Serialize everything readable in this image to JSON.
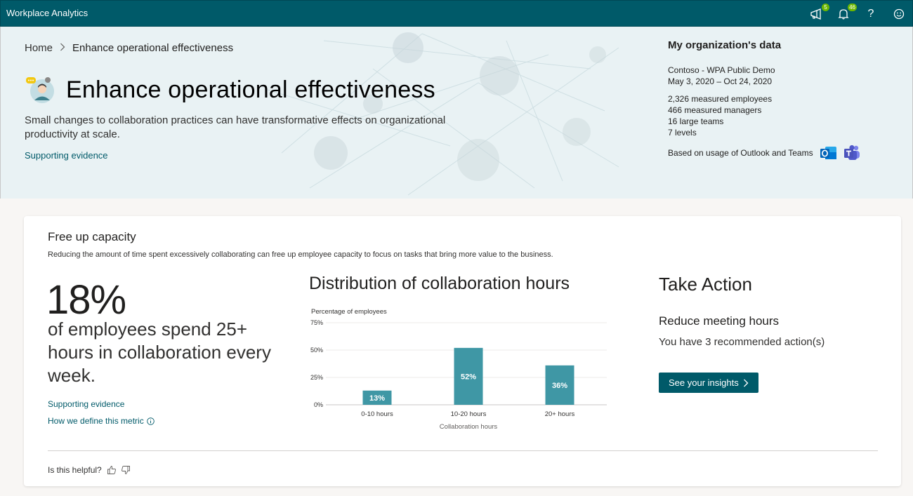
{
  "app": {
    "title": "Workplace Analytics"
  },
  "topbar": {
    "announcements_badge": "5",
    "notifications_badge": "46",
    "help_symbol": "?"
  },
  "breadcrumb": {
    "home": "Home",
    "current": "Enhance operational effectiveness"
  },
  "hero": {
    "title": "Enhance operational effectiveness",
    "description": "Small changes to collaboration practices can have transformative effects on organizational productivity at scale.",
    "link": "Supporting evidence"
  },
  "org": {
    "heading": "My organization's data",
    "name": "Contoso - WPA Public Demo",
    "date_range": "May 3, 2020 – Oct 24, 2020",
    "employees": "2,326 measured employees",
    "managers": "466 measured managers",
    "teams": "16 large teams",
    "levels": "7 levels",
    "usage_text": "Based on usage of Outlook and Teams"
  },
  "card": {
    "title": "Free up capacity",
    "subtitle": "Reducing the amount of time spent excessively collaborating can free up employee capacity to focus on tasks that bring more value to the business.",
    "stat_value": "18%",
    "stat_text": "of employees spend 25+ hours in collaboration every week.",
    "link_evidence": "Supporting evidence",
    "link_define": "How we define this metric",
    "chart_title": "Distribution of collaboration hours",
    "action_title": "Take Action",
    "action_subtitle": "Reduce meeting hours",
    "action_text": "You have 3 recommended action(s)",
    "action_button": "See your insights",
    "helpful": "Is this helpful?"
  },
  "colors": {
    "brand": "#005a69",
    "bar": "#3f97a5",
    "badge": "#6bb700"
  },
  "chart_data": {
    "type": "bar",
    "title": "Distribution of collaboration hours",
    "ylabel": "Percentage of employees",
    "xlabel": "Collaboration hours",
    "categories": [
      "0-10 hours",
      "10-20 hours",
      "20+ hours"
    ],
    "values": [
      13,
      52,
      36
    ],
    "value_labels": [
      "13%",
      "52%",
      "36%"
    ],
    "yticks": [
      "75%",
      "50%",
      "25%",
      "0%"
    ],
    "ytick_values": [
      75,
      50,
      25,
      0
    ],
    "ylim": [
      0,
      75
    ],
    "grid": true
  }
}
